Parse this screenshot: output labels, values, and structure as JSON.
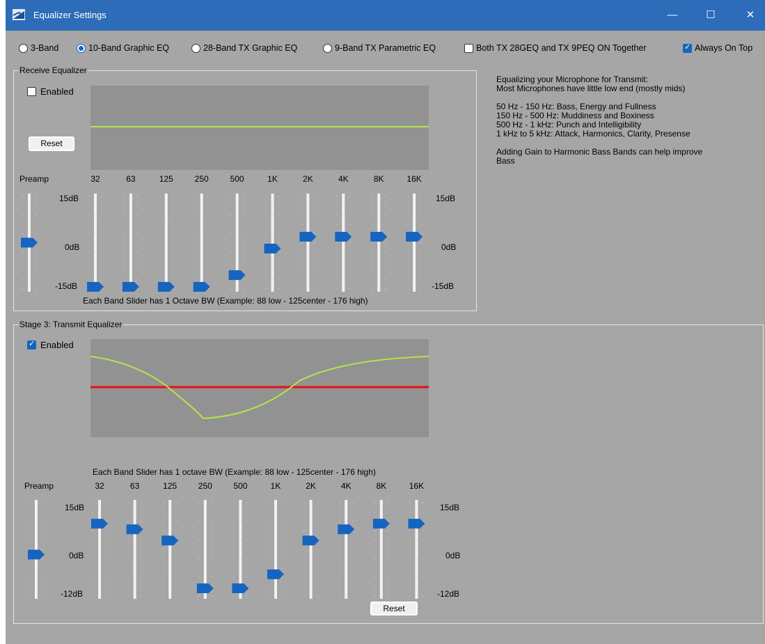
{
  "window": {
    "title": "Equalizer Settings",
    "minimize": "—",
    "maximize": "☐",
    "close": "✕"
  },
  "mode_options": [
    {
      "label": "3-Band",
      "type": "radio",
      "checked": false
    },
    {
      "label": "10-Band Graphic EQ",
      "type": "radio",
      "checked": true
    },
    {
      "label": "28-Band TX Graphic EQ",
      "type": "radio",
      "checked": false
    },
    {
      "label": "9-Band TX Parametric EQ",
      "type": "radio",
      "checked": false
    },
    {
      "label": "Both TX 28GEQ and TX 9PEQ ON Together",
      "type": "checkbox",
      "checked": false
    },
    {
      "label": "Always On Top",
      "type": "checkbox",
      "checked": true
    }
  ],
  "receive": {
    "title": "Receive Equalizer",
    "enabled_label": "Enabled",
    "enabled": false,
    "reset_label": "Reset",
    "preamp_label": "Preamp",
    "bands": [
      "32",
      "63",
      "125",
      "250",
      "500",
      "1K",
      "2K",
      "4K",
      "8K",
      "16K"
    ],
    "scale_top": "15dB",
    "scale_mid": "0dB",
    "scale_bot": "-15dB",
    "note": "Each Band Slider has 1 Octave BW (Example: 88 low - 125center  - 176 high)",
    "range": [
      -15,
      15
    ],
    "preamp_db": 0,
    "band_db": [
      -15,
      -15,
      -15,
      -15,
      -11,
      -2,
      2,
      2,
      2,
      2
    ]
  },
  "transmit": {
    "title": "Stage 3: Transmit Equalizer",
    "enabled_label": "Enabled",
    "enabled": true,
    "reset_label": "Reset",
    "preamp_label": "Preamp",
    "bands": [
      "32",
      "63",
      "125",
      "250",
      "500",
      "1K",
      "2K",
      "4K",
      "8K",
      "16K"
    ],
    "scale_top": "15dB",
    "scale_mid": "0dB",
    "scale_bot": "-12dB",
    "note": "Each Band Slider has 1 octave BW (Example: 88 low - 125center  - 176 high)",
    "range": [
      -12,
      15
    ],
    "preamp_db": 0,
    "band_db": [
      11,
      9,
      5,
      -12,
      -12,
      -7,
      5,
      9,
      11,
      11
    ]
  },
  "info": {
    "line1": "Equalizing your Microphone for Transmit:",
    "line2": "Most Microphones have little low end (mostly mids)",
    "line3": "50 Hz - 150 Hz: Bass, Energy and Fullness",
    "line4": "150 Hz - 500 Hz: Muddiness and Boxiness",
    "line5": "500 Hz - 1 kHz: Punch and Intelligibility",
    "line6": "1 kHz to 5 kHz: Attack, Harmonics, Clarity, Presense",
    "line7": "Adding Gain to Harmonic Bass Bands can help improve",
    "line8": "Bass"
  },
  "colors": {
    "titlebar": "#2c6cb8",
    "slider_thumb": "#1565c0",
    "curve": "#b5e645",
    "baseline": "#e81010"
  }
}
